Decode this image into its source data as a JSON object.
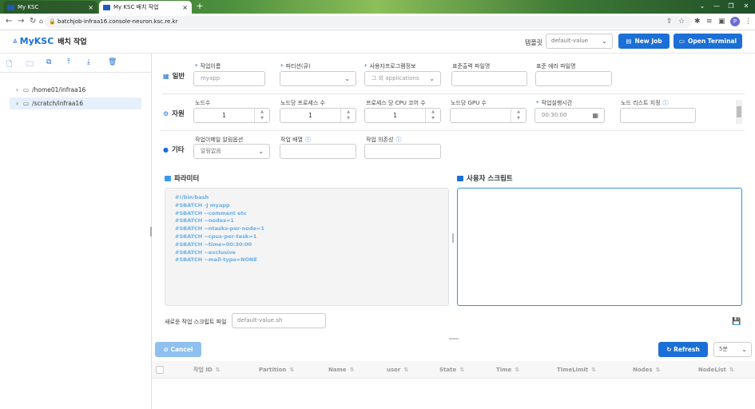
{
  "browser": {
    "tabs": [
      {
        "label": "My KSC",
        "active": false
      },
      {
        "label": "My KSC 배치 작업",
        "active": true
      }
    ],
    "url": "batchjob-infraa16.console-neuron.ksc.re.kr",
    "profile_initial": "P"
  },
  "header": {
    "brand": "MyKSC",
    "title": "배치 작업",
    "template_label": "템플릿",
    "template_value": "default-value",
    "new_job_label": "New Job",
    "open_terminal_label": "Open Terminal",
    "accent_color": "#1b6fd6"
  },
  "sidebar": {
    "tree": [
      {
        "label": "/home01/infraa16",
        "selected": false
      },
      {
        "label": "/scratch/infraa16",
        "selected": true
      }
    ]
  },
  "form": {
    "general": {
      "section_label": "일반",
      "job_name_label": "작업이름",
      "job_name_placeholder": "myapp",
      "partition_label": "파티션(큐)",
      "app_info_label": "사용자프로그램정보",
      "app_info_value": "그 외 applications",
      "stdout_label": "표준출력 파일명",
      "stderr_label": "표준 에러 파일명"
    },
    "resources": {
      "section_label": "자원",
      "nodes_label": "노드수",
      "nodes_value": "1",
      "procs_label": "노드당 프로세스 수",
      "procs_value": "1",
      "cpu_label": "프로세스 당 CPU 코어 수",
      "cpu_value": "1",
      "gpu_label": "노드당 GPU 수",
      "gpu_value": "",
      "time_label": "작업실행시간",
      "time_value": "00:30:00",
      "nodelist_label": "노드 리스트 지정"
    },
    "other": {
      "section_label": "기타",
      "mail_label": "작업이메일 알림옵션",
      "mail_value": "알림없음",
      "array_label": "작업 배열",
      "dependency_label": "작업 의존성"
    }
  },
  "params": {
    "title": "파라미터",
    "lines": [
      "#!/bin/bash",
      "#SBATCH -J myapp",
      "#SBATCH --comment etc",
      "#SBATCH --nodes=1",
      "#SBATCH --ntasks-per-node=1",
      "#SBATCH --cpus-per-task=1",
      "#SBATCH --time=00:30:00",
      "#SBATCH --exclusive",
      "#SBATCH --mail-type=NONE"
    ]
  },
  "user_script": {
    "title": "사용자 스크립트"
  },
  "script_file": {
    "label": "새로운 작업 스크립트 파일",
    "placeholder": "default-value.sh"
  },
  "job_table": {
    "cancel_label": "Cancel",
    "refresh_label": "Refresh",
    "interval_value": "5분",
    "columns": [
      "작업 ID",
      "Partition",
      "Name",
      "user",
      "State",
      "Time",
      "TimeLimit",
      "Nodes",
      "NodeList"
    ]
  }
}
